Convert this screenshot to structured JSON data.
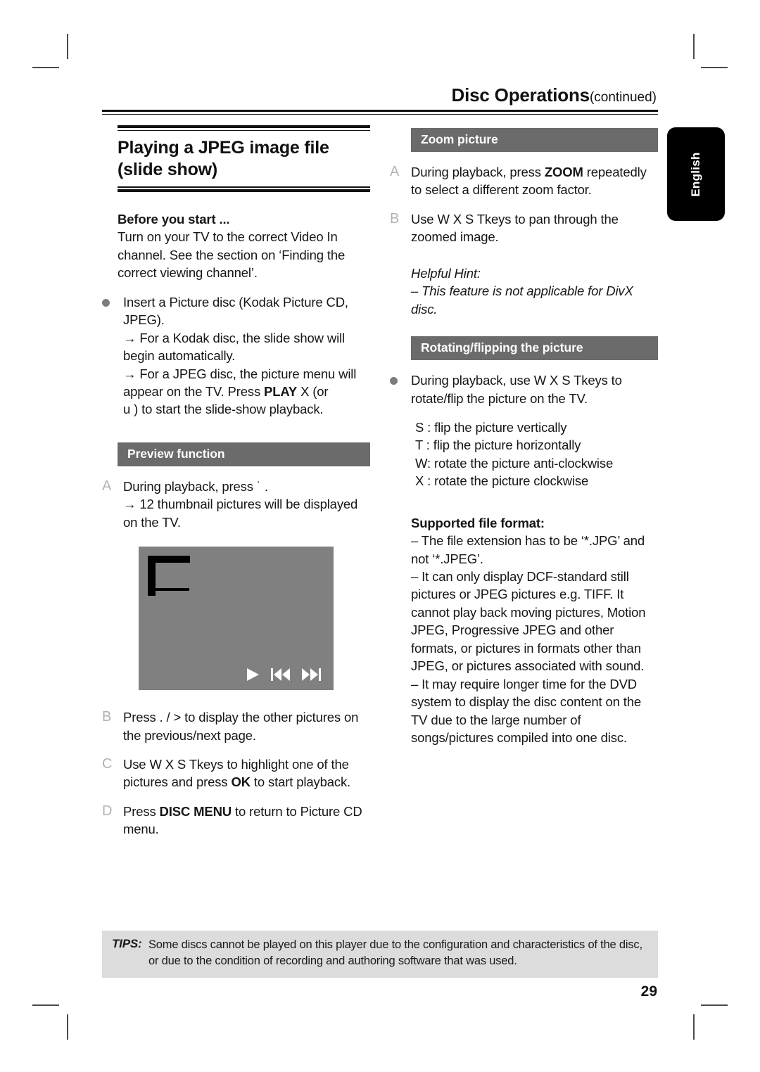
{
  "running_head": {
    "title": "Disc Operations",
    "continued": "(continued)"
  },
  "language_tab": {
    "label": "English"
  },
  "left_column": {
    "main_title": "Playing a JPEG image file\n(slide show)",
    "main_title_line1": "Playing a JPEG image file",
    "main_title_line2": "(slide show)",
    "before_you_start": {
      "heading": "Before you start ...",
      "text": "Turn on your TV to the correct Video In channel.  See the section on ‘Finding the correct viewing channel’."
    },
    "insert_disc": {
      "marker": "bullet",
      "text_a": "Insert a Picture disc (Kodak Picture CD, JPEG).",
      "arrow1": "→ For a Kodak disc, the slide show will begin automatically.",
      "arrow2_part1": "→ For a JPEG disc, the picture menu will appear on the TV.  Press ",
      "arrow2_bold": "PLAY",
      "arrow2_part2": " X (or",
      "arrow2_line": "u   ) to start the slide-show playback."
    },
    "preview_section": {
      "bar_label": "Preview function",
      "items": [
        {
          "marker": "A",
          "line1": "During playback, press ˙  .",
          "line2": "→ 12 thumbnail pictures will be displayed on the TV."
        },
        {
          "marker": "B",
          "line1": "Press .     / >     to display the other pictures on the previous/next page."
        },
        {
          "marker": "C",
          "pre": "Use  W X S Tkeys to highlight one of the pictures and press ",
          "bold": "OK",
          "post": " to start playback."
        },
        {
          "marker": "D",
          "pre": "Press ",
          "bold": "DISC MENU",
          "post": " to return to Picture CD menu."
        }
      ]
    },
    "screenshot": {
      "alt": "TV screen preview illustration",
      "icons": [
        "play-icon",
        "previous-track-icon",
        "next-track-icon"
      ]
    }
  },
  "right_column": {
    "zoom_section": {
      "bar_label": "Zoom picture",
      "items": [
        {
          "marker": "A",
          "pre": "During playback, press ",
          "bold": "ZOOM",
          "post": " repeatedly to select a different zoom factor."
        },
        {
          "marker": "B",
          "text": "Use  W X S Tkeys to pan through the zoomed image."
        }
      ],
      "helpful_hint_label": "Helpful Hint:",
      "helpful_hint_text": "– This feature is not applicable for DivX disc."
    },
    "rotate_section": {
      "bar_label": "Rotating/flipping the picture",
      "bullet_text": "During playback, use  W X S Tkeys to rotate/flip the picture on the TV.",
      "key_list": [
        "S : flip the picture vertically",
        "T : flip the picture horizontally",
        "W: rotate the picture anti-clockwise",
        "X : rotate the picture clockwise"
      ]
    },
    "supported_format": {
      "heading": "Supported file format:",
      "items": [
        "–   The file extension has to be ‘*.JPG’ and not ‘*.JPEG’.",
        "–   It can only display DCF-standard still pictures or JPEG pictures e.g. TIFF.  It cannot play back moving pictures, Motion JPEG, Progressive JPEG and other formats, or pictures in formats other than JPEG, or pictures associated with sound.",
        "–   It may require longer time for the DVD system to display the disc content on the TV due to the large number of songs/pictures compiled into one disc."
      ]
    }
  },
  "tips": {
    "label": "TIPS:",
    "text": "Some discs cannot be played on this player due to the configuration and characteristics of the disc, or due to the condition of recording and authoring software that was used."
  },
  "page_number": "29",
  "colors": {
    "section_bar": "#6b6b6b",
    "tips_background": "#dcdcdc",
    "screen_background": "#808080",
    "marker_letter": "#b2b2b2",
    "bullet": "#7d7d7d"
  }
}
